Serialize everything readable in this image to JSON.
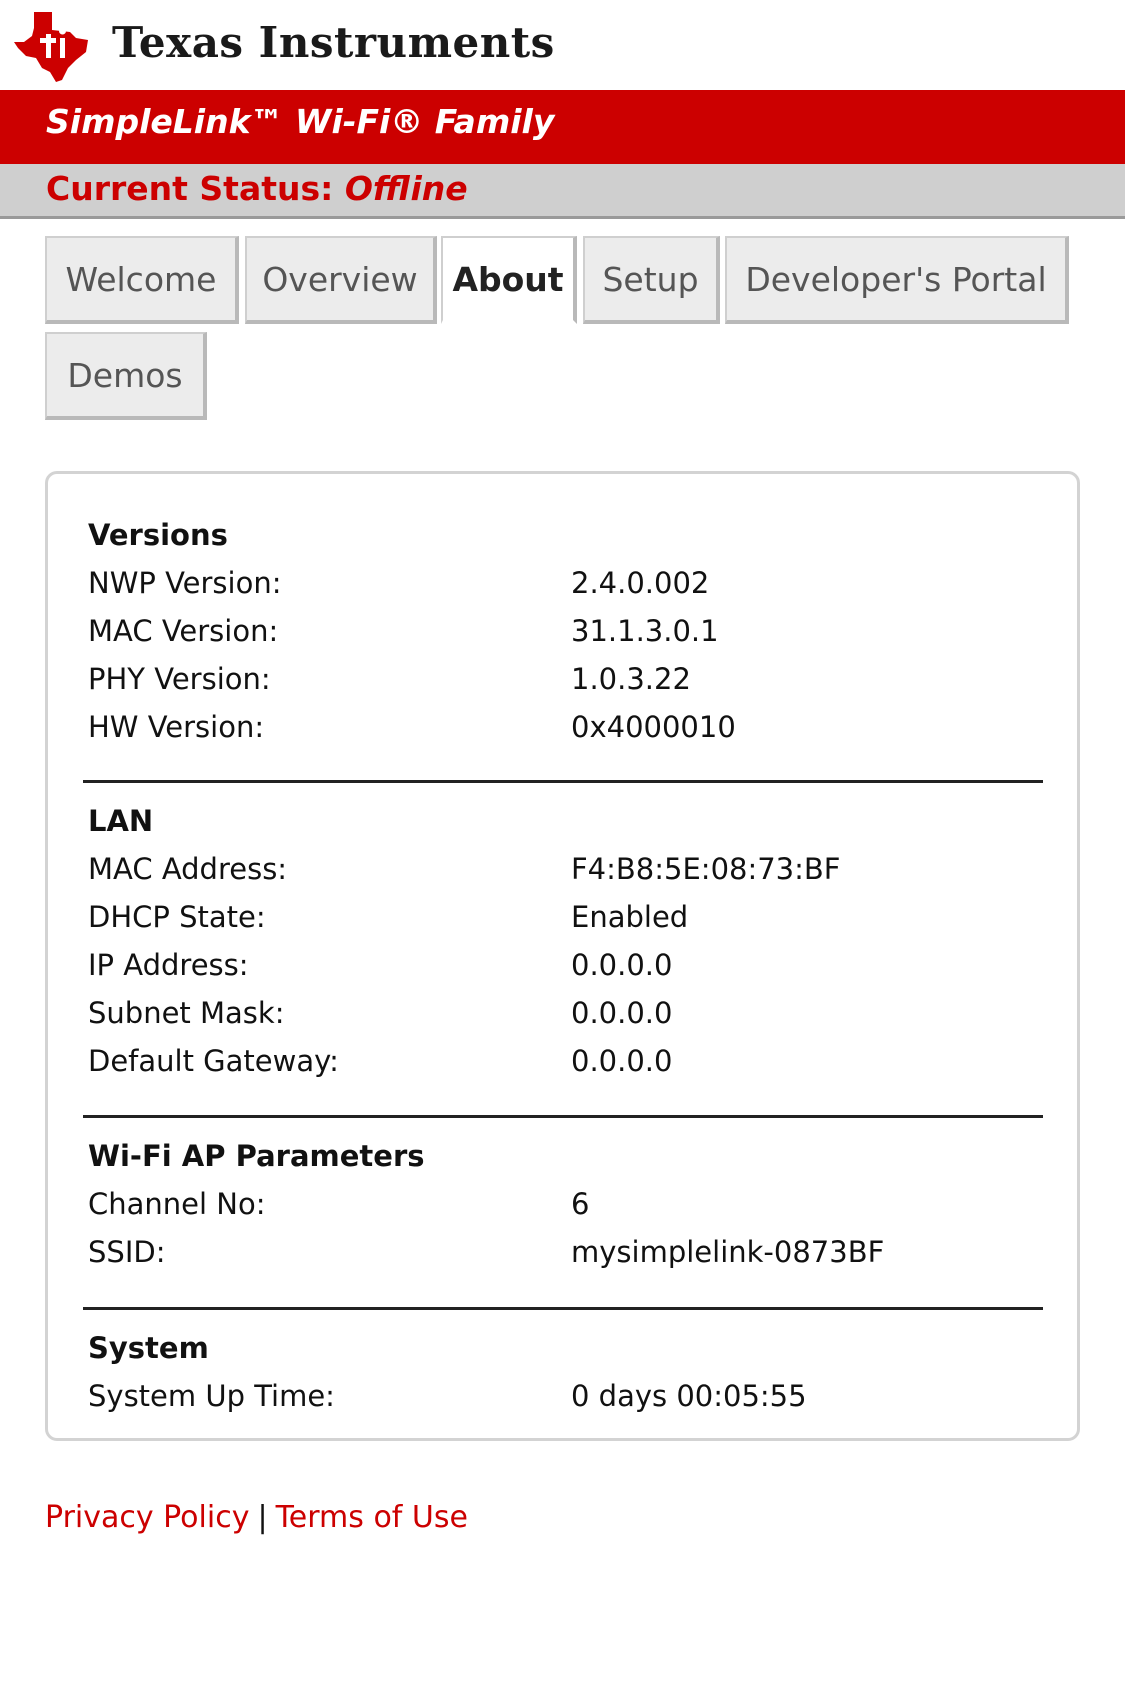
{
  "header": {
    "brand_name": "Texas Instruments",
    "product_family": "SimpleLink™ Wi-Fi® Family",
    "status_label": "Current Status:",
    "status_value": "Offline",
    "accent_color": "#cc0000"
  },
  "tabs": [
    {
      "label": "Welcome",
      "active": false
    },
    {
      "label": "Overview",
      "active": false
    },
    {
      "label": "About",
      "active": true
    },
    {
      "label": "Setup",
      "active": false
    },
    {
      "label": "Developer's Portal",
      "active": false
    },
    {
      "label": "Demos",
      "active": false
    }
  ],
  "sections": {
    "versions": {
      "title": "Versions",
      "rows": [
        {
          "label": "NWP Version:",
          "value": "2.4.0.002"
        },
        {
          "label": "MAC Version:",
          "value": "31.1.3.0.1"
        },
        {
          "label": "PHY Version:",
          "value": "1.0.3.22"
        },
        {
          "label": "HW Version:",
          "value": "0x4000010"
        }
      ]
    },
    "lan": {
      "title": "LAN",
      "rows": [
        {
          "label": "MAC Address:",
          "value": "F4:B8:5E:08:73:BF"
        },
        {
          "label": "DHCP State:",
          "value": "Enabled"
        },
        {
          "label": "IP Address:",
          "value": "0.0.0.0"
        },
        {
          "label": "Subnet Mask:",
          "value": "0.0.0.0"
        },
        {
          "label": "Default Gateway:",
          "value": "0.0.0.0"
        }
      ]
    },
    "wifi_ap": {
      "title": "Wi-Fi AP Parameters",
      "rows": [
        {
          "label": "Channel No:",
          "value": "6"
        },
        {
          "label": "SSID:",
          "value": "mysimplelink-0873BF"
        }
      ]
    },
    "system": {
      "title": "System",
      "rows": [
        {
          "label": "System Up Time:",
          "value": "0 days 00:05:55"
        }
      ]
    }
  },
  "footer": {
    "privacy_link": "Privacy Policy",
    "separator": "|",
    "terms_link": "Terms of Use"
  }
}
